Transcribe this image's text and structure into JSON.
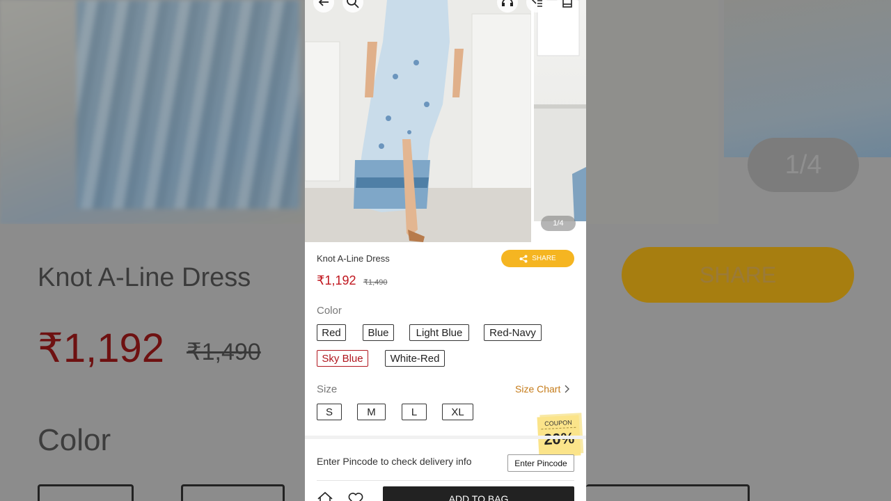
{
  "backdrop": {
    "title": "Knot A-Line Dress",
    "price": "₹1,192",
    "mrp": "₹1,490",
    "color_label": "Color",
    "share_label": "SHARE",
    "counter": "1/4"
  },
  "gallery": {
    "counter": "1/4",
    "icons": [
      "back-arrow-icon",
      "search-icon",
      "customer-support-icon",
      "wishlist-list-icon",
      "bag-icon"
    ]
  },
  "product": {
    "title": "Knot A-Line Dress",
    "price": "₹1,192",
    "mrp": "₹1,490",
    "share_label": "SHARE"
  },
  "colors": {
    "label": "Color",
    "selected": "Sky Blue",
    "options": [
      "Red",
      "Blue",
      "Light Blue",
      "Red-Navy",
      "Sky Blue",
      "White-Red"
    ]
  },
  "sizes": {
    "label": "Size",
    "size_chart": "Size Chart",
    "options": [
      "S",
      "M",
      "L",
      "XL"
    ]
  },
  "delivery": {
    "prompt": "Enter Pincode to check delivery info",
    "button": "Enter Pincode"
  },
  "coupon": {
    "label": "COUPON",
    "value": "20%"
  },
  "footer": {
    "add_to_bag": "ADD TO BAG"
  },
  "colors_theme": {
    "price_red": "#c0161e",
    "share_yellow": "#f5b521",
    "size_chart_orange": "#c57b19",
    "selected_border": "#b0161e"
  }
}
